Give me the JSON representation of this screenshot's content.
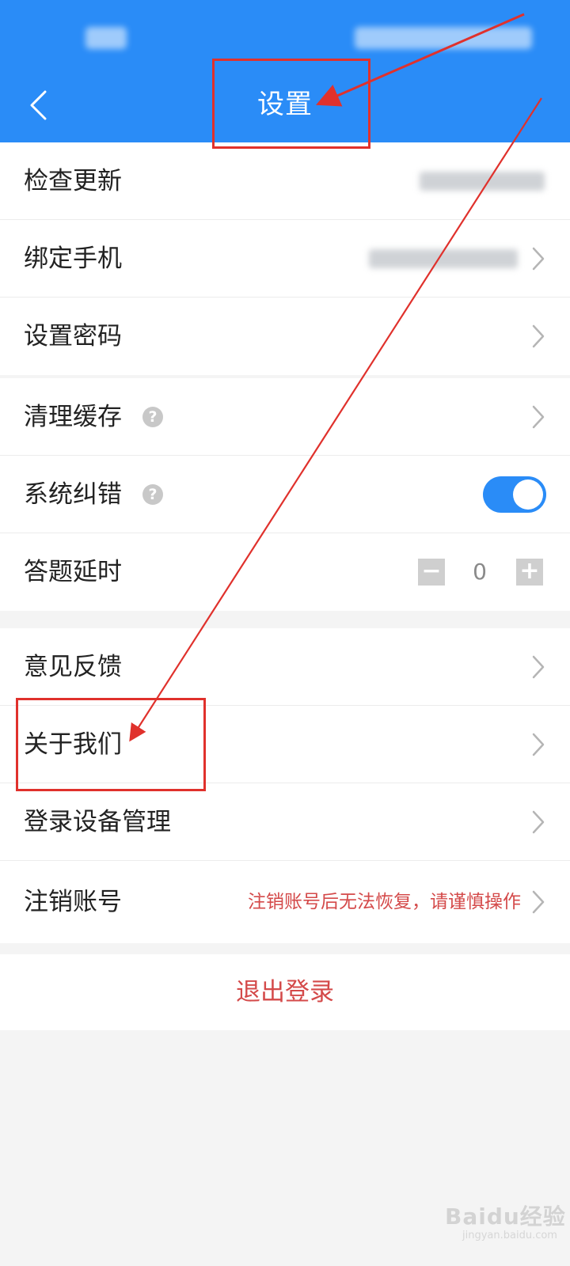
{
  "header": {
    "title": "设置",
    "back_icon": "chevron-left-icon"
  },
  "groups": [
    {
      "items": [
        {
          "label": "检查更新"
        },
        {
          "label": "绑定手机"
        },
        {
          "label": "设置密码"
        }
      ]
    },
    {
      "items": [
        {
          "label": "清理缓存",
          "help": "?"
        },
        {
          "label": "系统纠错",
          "help": "?",
          "toggle_on": true
        },
        {
          "label": "答题延时",
          "stepper": {
            "minus": "−",
            "value": "0",
            "plus": "+"
          }
        }
      ]
    },
    {
      "items": [
        {
          "label": "意见反馈"
        },
        {
          "label": "关于我们"
        },
        {
          "label": "登录设备管理"
        },
        {
          "label": "注销账号",
          "note": "注销账号后无法恢复，请谨慎操作"
        }
      ]
    }
  ],
  "logout": {
    "label": "退出登录"
  },
  "colors": {
    "brand_blue": "#2a8cf7",
    "danger_red": "#d44a4a",
    "annotation_red": "#e0312c",
    "background": "#f4f4f4"
  },
  "watermark": {
    "text": "Baidu经验",
    "sub": "jingyan.baidu.com"
  }
}
